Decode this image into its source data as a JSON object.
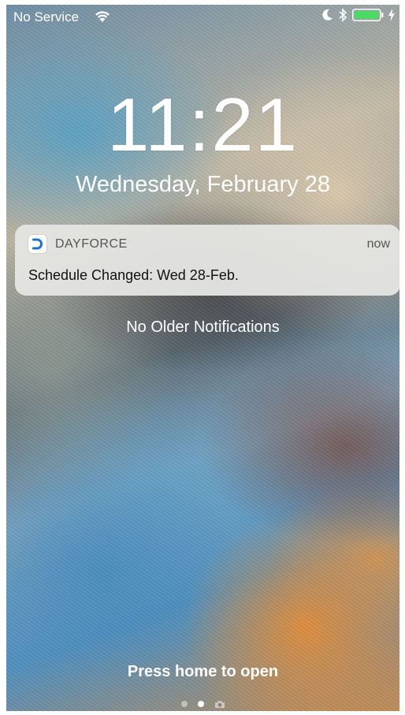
{
  "status_bar": {
    "carrier": "No Service",
    "icons": [
      "wifi-icon",
      "moon-icon",
      "bluetooth-icon",
      "battery-icon",
      "charging-icon"
    ],
    "battery_color": "#4cd964"
  },
  "lock_screen": {
    "time": "11:21",
    "date": "Wednesday, February 28"
  },
  "notification": {
    "app_name": "DAYFORCE",
    "time": "now",
    "message": "Schedule Changed: Wed 28-Feb.",
    "icon_color": "#1a6fd8"
  },
  "no_older_text": "No Older Notifications",
  "press_home_text": "Press home to open",
  "page_indicator": {
    "pages": 3,
    "active_index": 1
  }
}
